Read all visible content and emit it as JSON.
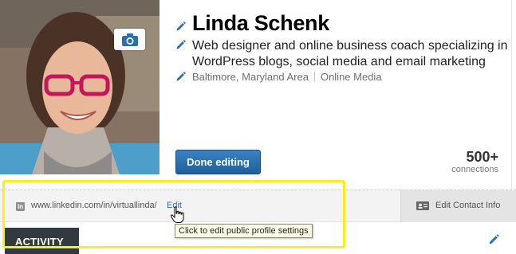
{
  "profile": {
    "name": "Linda Schenk",
    "headline": "Web designer and online business coach specializing in WordPress blogs, social media and email marketing",
    "location": "Baltimore, Maryland Area",
    "industry": "Online Media",
    "photo_button_icon": "camera-icon"
  },
  "actions": {
    "done_editing_label": "Done editing"
  },
  "connections": {
    "count": "500+",
    "label": "connections"
  },
  "public_profile": {
    "url": "www.linkedin.com/in/virtuallinda/",
    "edit_label": "Edit",
    "tooltip": "Click to edit public profile settings",
    "icon": "linkedin-icon"
  },
  "contact": {
    "label": "Edit Contact Info",
    "icon": "contact-card-icon"
  },
  "sections": {
    "activity_label": "ACTIVITY"
  },
  "colors": {
    "accent_blue": "#2e6eb5",
    "button_blue": "#2a6faf",
    "highlight_yellow": "#f7f01e",
    "activity_bg": "#333a3f"
  }
}
